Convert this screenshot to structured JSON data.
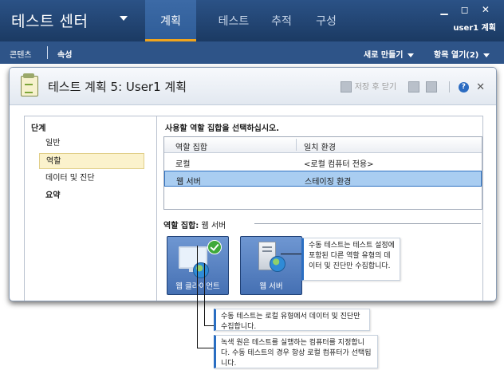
{
  "app": {
    "title": "테스트 센터",
    "tabs": [
      {
        "label": "계획",
        "active": true
      },
      {
        "label": "테스트",
        "active": false
      },
      {
        "label": "추적",
        "active": false
      },
      {
        "label": "구성",
        "active": false
      }
    ],
    "window_controls": "▁ ◻ ✕",
    "user": "user1 계획"
  },
  "subnav": {
    "contents": "콘텐츠",
    "properties": "속성",
    "new": "새로 만들기",
    "open_items": "항목 열기(2)"
  },
  "dialog": {
    "title": "테스트 계획 5: User1 계획",
    "save_close": "저장 후 닫기",
    "help": "?",
    "close": "✕",
    "steps_header": "단계",
    "steps": [
      {
        "label": "일반",
        "selected": false,
        "bold": false
      },
      {
        "label": "역할",
        "selected": true,
        "bold": false
      },
      {
        "label": "데이터 및 진단",
        "selected": false,
        "bold": false
      },
      {
        "label": "요약",
        "selected": false,
        "bold": true
      }
    ],
    "instruction": "사용할 역할 집합을 선택하십시오.",
    "grid": {
      "columns": [
        "역할 집합",
        "일치 환경"
      ],
      "rows": [
        {
          "role_set": "로컬",
          "environment": "<로컬 컴퓨터 전용>",
          "selected": false
        },
        {
          "role_set": "웹 서버",
          "environment": "스테이징 환경",
          "selected": true
        }
      ]
    },
    "roles_label_prefix": "역할 집합:",
    "roles_label_value": "웹 서버",
    "roles": [
      {
        "label": "웹 클라이언트",
        "icon": "monitor-globe-icon",
        "has_check": true
      },
      {
        "label": "웹 서버",
        "icon": "server-globe-icon",
        "has_check": false
      }
    ]
  },
  "callouts": {
    "right": "수동 테스트는 테스트 설정에 포함된 다른 역할 유형의 데이터 및 진단만 수집합니다.",
    "bottom1": "수동 테스트는 로컬 유형에서 데이터 및 진단만 수집합니다.",
    "bottom2": "녹색 원은 테스트를 실행하는 컴퓨터를 지정합니다. 수동 테스트의 경우 항상 로컬 컴퓨터가 선택됩니다."
  },
  "colors": {
    "topbar": "#1d3e6a",
    "subbar": "#2e5488",
    "active_tab_underline": "#f0a41c",
    "selection": "#a9cdf1",
    "step_selection": "#fbf2cc",
    "role_tile": "#4570b3"
  }
}
